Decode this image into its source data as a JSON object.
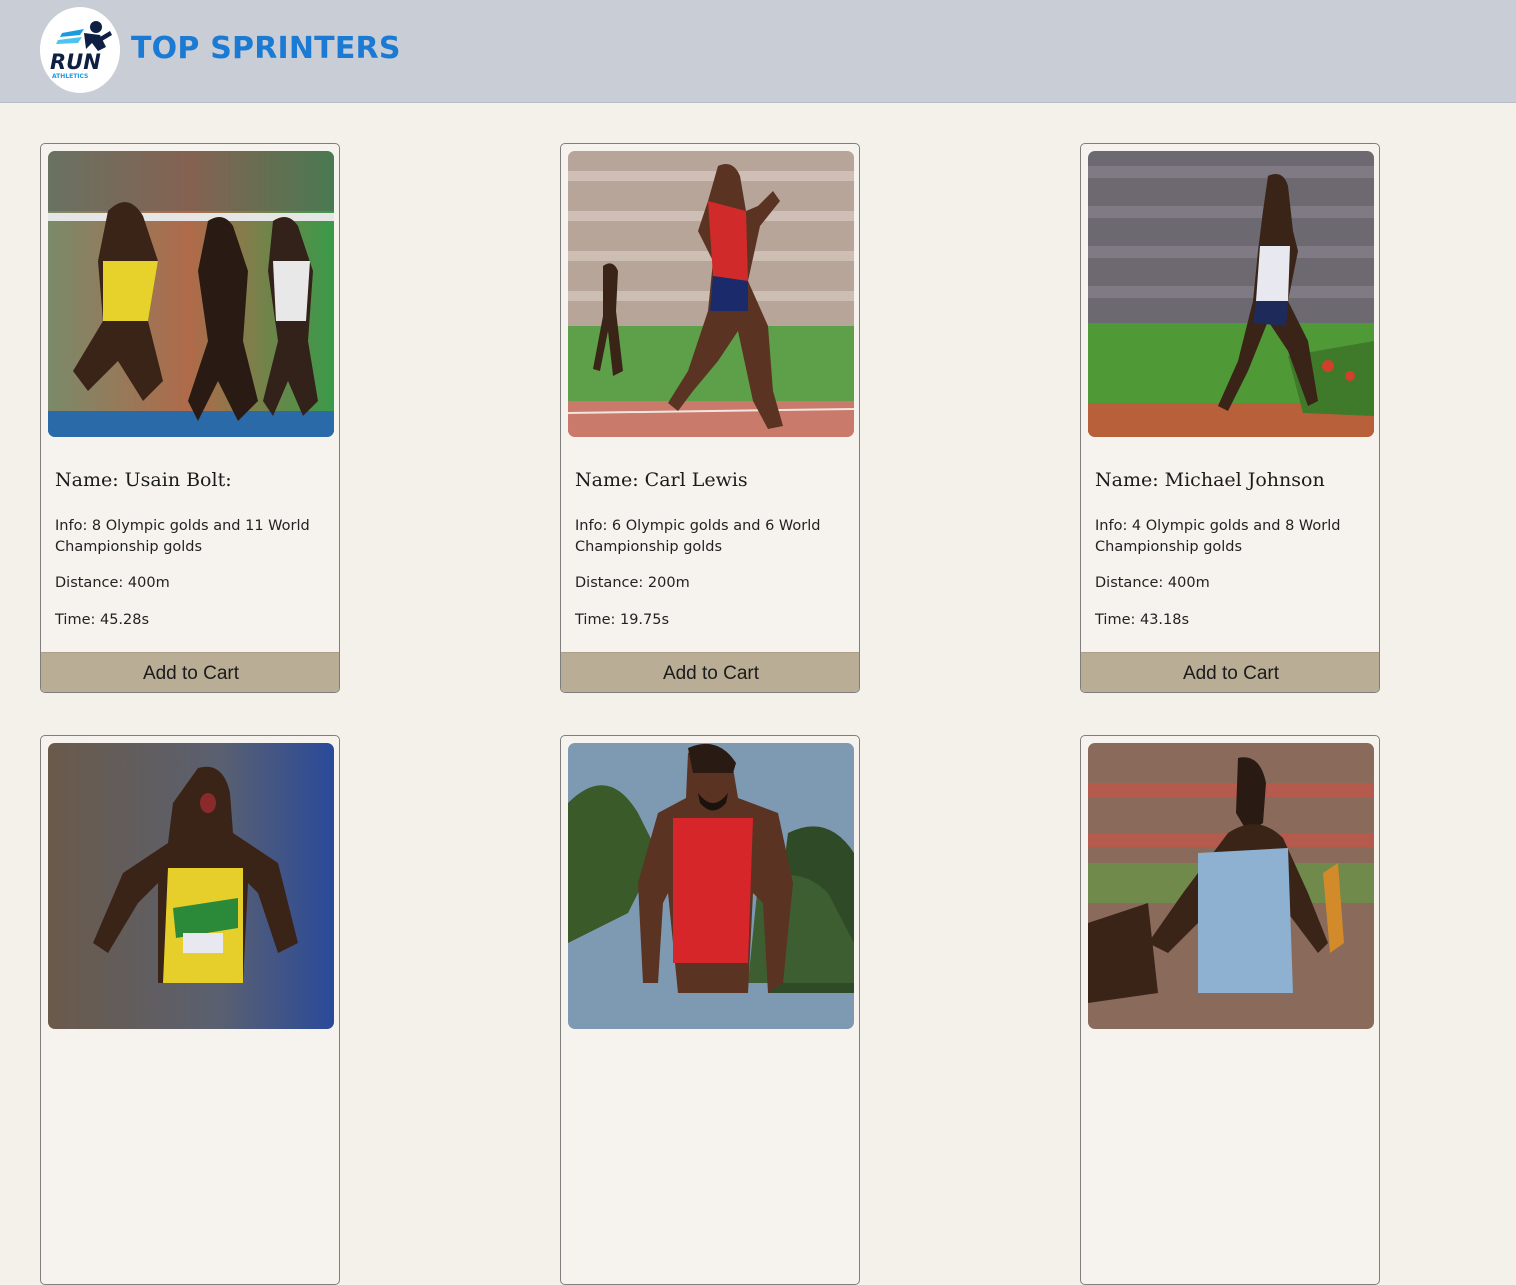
{
  "header": {
    "logo_text": "RUN",
    "logo_subtext": "ATHLETICS",
    "title": "TOP SPRINTERS"
  },
  "icons": {
    "logo": "runner-logo-icon"
  },
  "colors": {
    "header_bg": "#c9cdd5",
    "title": "#1a7ad4",
    "page_bg": "#f4f1eb",
    "button_bg": "#b9ad95"
  },
  "cards": [
    {
      "name": "Name: Usain Bolt:",
      "info": "Info: 8 Olympic golds and 11 World Championship golds",
      "distance": "Distance: 400m",
      "time": "Time: 45.28s",
      "button": "Add to Cart"
    },
    {
      "name": "Name: Carl Lewis",
      "info": "Info: 6 Olympic golds and 6 World Championship golds",
      "distance": "Distance: 200m",
      "time": "Time: 19.75s",
      "button": "Add to Cart"
    },
    {
      "name": "Name: Michael Johnson",
      "info": "Info: 4 Olympic golds and 8 World Championship golds",
      "distance": "Distance: 400m",
      "time": "Time: 43.18s",
      "button": "Add to Cart"
    },
    {
      "name": "",
      "info": "",
      "distance": "",
      "time": "",
      "button": ""
    },
    {
      "name": "",
      "info": "",
      "distance": "",
      "time": "",
      "button": ""
    },
    {
      "name": "",
      "info": "",
      "distance": "",
      "time": "",
      "button": ""
    }
  ]
}
